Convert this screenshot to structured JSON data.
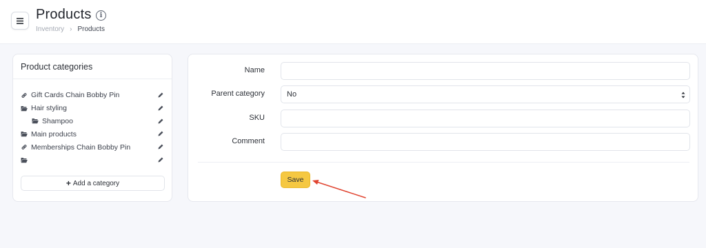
{
  "header": {
    "title": "Products",
    "breadcrumb": [
      "Inventory",
      "Products"
    ]
  },
  "categories": {
    "heading": "Product categories",
    "items": [
      {
        "label": "Gift Cards Chain Bobby Pin",
        "icon": "link-icon",
        "indent": 0
      },
      {
        "label": "Hair styling",
        "icon": "folder-open-icon",
        "indent": 0
      },
      {
        "label": "Shampoo",
        "icon": "folder-open-icon",
        "indent": 1
      },
      {
        "label": "Main products",
        "icon": "folder-open-icon",
        "indent": 0
      },
      {
        "label": "Memberships Chain Bobby Pin",
        "icon": "link-icon",
        "indent": 0
      },
      {
        "label": "",
        "icon": "folder-open-icon",
        "indent": 0
      }
    ],
    "add_label": "Add a category"
  },
  "form": {
    "name_label": "Name",
    "name_value": "",
    "parent_label": "Parent category",
    "parent_value": "No",
    "sku_label": "SKU",
    "sku_value": "",
    "comment_label": "Comment",
    "comment_value": "",
    "save_label": "Save"
  },
  "colors": {
    "accent": "#f5c842",
    "annotation_arrow": "#e0432f",
    "background": "#f6f7fb"
  }
}
